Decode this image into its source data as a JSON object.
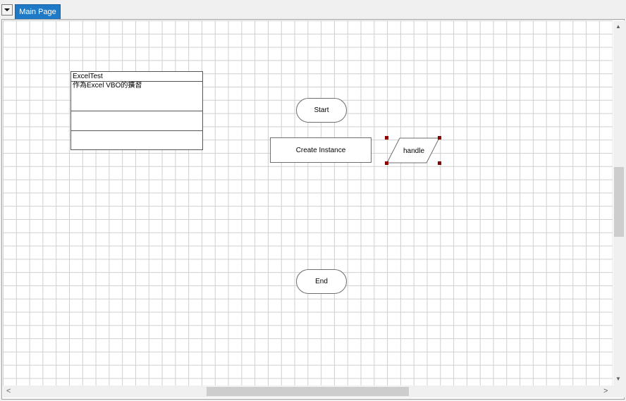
{
  "tabs": {
    "active_label": "Main Page"
  },
  "note": {
    "title": "ExcelTest",
    "description": "作為Excel VBO的擴習"
  },
  "stages": {
    "start_label": "Start",
    "process_label": "Create Instance",
    "data_label": "handle",
    "end_label": "End"
  },
  "icons": {
    "tab_menu": "dropdown-triangle-icon",
    "scroll_up": "▲",
    "scroll_down": "▼",
    "scroll_left": "<",
    "scroll_right": ">"
  }
}
